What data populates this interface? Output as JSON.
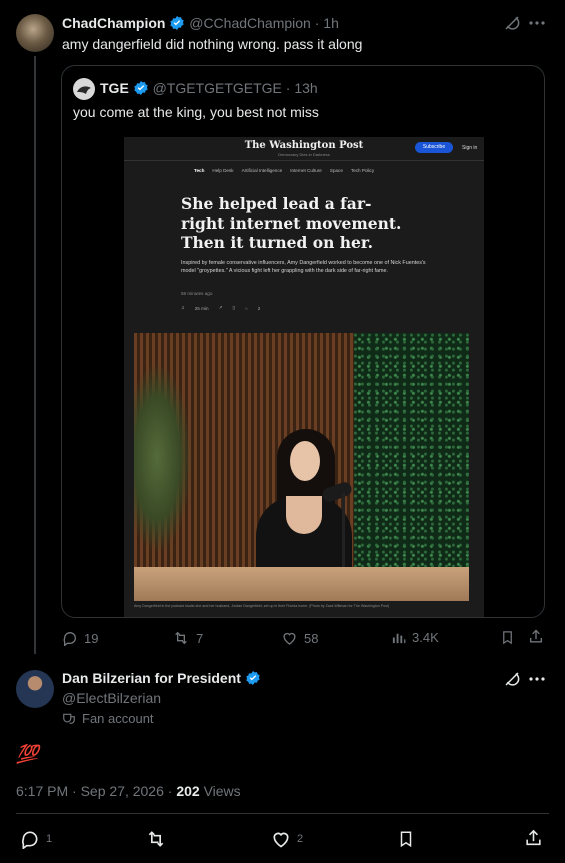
{
  "reply_tweet": {
    "name": "ChadChampion",
    "handle": "@CChadChampion",
    "time": "· 1h",
    "text": "amy dangerfield did nothing wrong. pass it along",
    "stats": {
      "replies": "19",
      "reposts": "7",
      "likes": "58",
      "views": "3.4K"
    }
  },
  "quoted_tweet": {
    "name": "TGE",
    "handle": "@TGETGETGETGE",
    "time": "· 13h",
    "text": "you come at the king, you best not miss"
  },
  "article": {
    "masthead": "The Washington Post",
    "tagline": "Democracy Dies in Darkness",
    "subscribe": "Subscribe",
    "signin": "Sign in",
    "nav": [
      "Tech",
      "Help Desk",
      "Artificial Intelligence",
      "Internet Culture",
      "Space",
      "Tech Policy"
    ],
    "headline": "She helped lead a far-right internet movement. Then it turned on her.",
    "dek": "Inspired by female conservative influencers, Amy Dangerfield worked to become one of Nick Fuentes's model \"groypettes.\" A vicious fight left her grappling with the dark side of far-right fame.",
    "timestamp": "58 minutes ago",
    "readtime": "25 min",
    "comments": "2",
    "caption": "Amy Dangerfield in the podcast studio she and her husband, Jordan Dangerfield, set up in their Florida home. (Photo by Zack Wittman for The Washington Post)"
  },
  "main_tweet": {
    "name": "Dan Bilzerian for President",
    "handle": "@ElectBilzerian",
    "fan_label": "Fan account",
    "text": "💯",
    "time": "6:17 PM · Sep 27, 2026 · ",
    "views_count": "202",
    "views_label": " Views",
    "stats": {
      "replies": "1",
      "likes": "2"
    }
  },
  "colors": {
    "accent": "#1d9bf0",
    "muted": "#71767b",
    "text": "#e7e9ea",
    "border": "#2f3336"
  }
}
